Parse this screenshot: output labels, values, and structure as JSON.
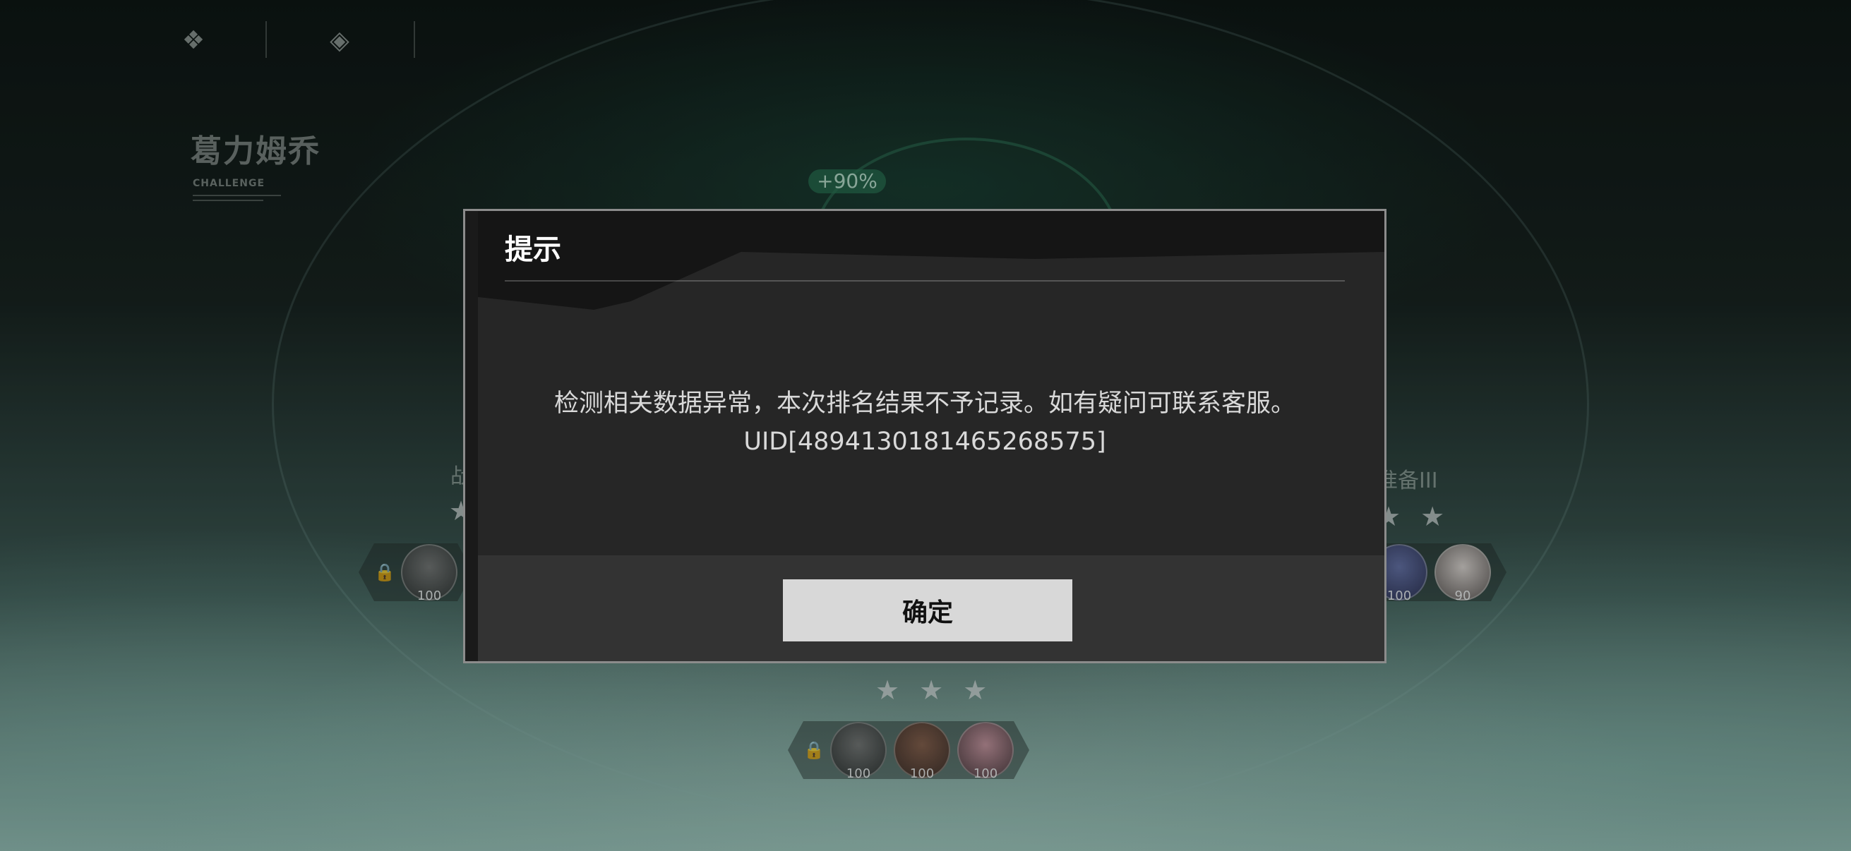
{
  "boss": {
    "name": "葛力姆乔",
    "subtitle": "CHALLENGE"
  },
  "bonus": "+90%",
  "side_labels": {
    "left": "战",
    "right": "准备III"
  },
  "stars": {
    "left": "★",
    "right": "★ ★",
    "center": "★ ★ ★"
  },
  "teams": {
    "left": {
      "lock_icon": "lock-icon",
      "members": [
        {
          "level": "100"
        }
      ]
    },
    "right": {
      "members": [
        {
          "level": "100"
        },
        {
          "level": "90"
        }
      ]
    },
    "center": {
      "lock_icon": "lock-icon",
      "members": [
        {
          "level": "100"
        },
        {
          "level": "100"
        },
        {
          "level": "100"
        }
      ]
    }
  },
  "dialog": {
    "title": "提示",
    "message": "检测相关数据异常，本次排名结果不予记录。如有疑问可联系客服。",
    "uid": "UID[4894130181465268575]",
    "confirm_label": "确定"
  },
  "colors": {
    "dialog_bg": "#262626",
    "button_bg": "#d8d8d8",
    "accent_green": "#2f7a5a"
  }
}
